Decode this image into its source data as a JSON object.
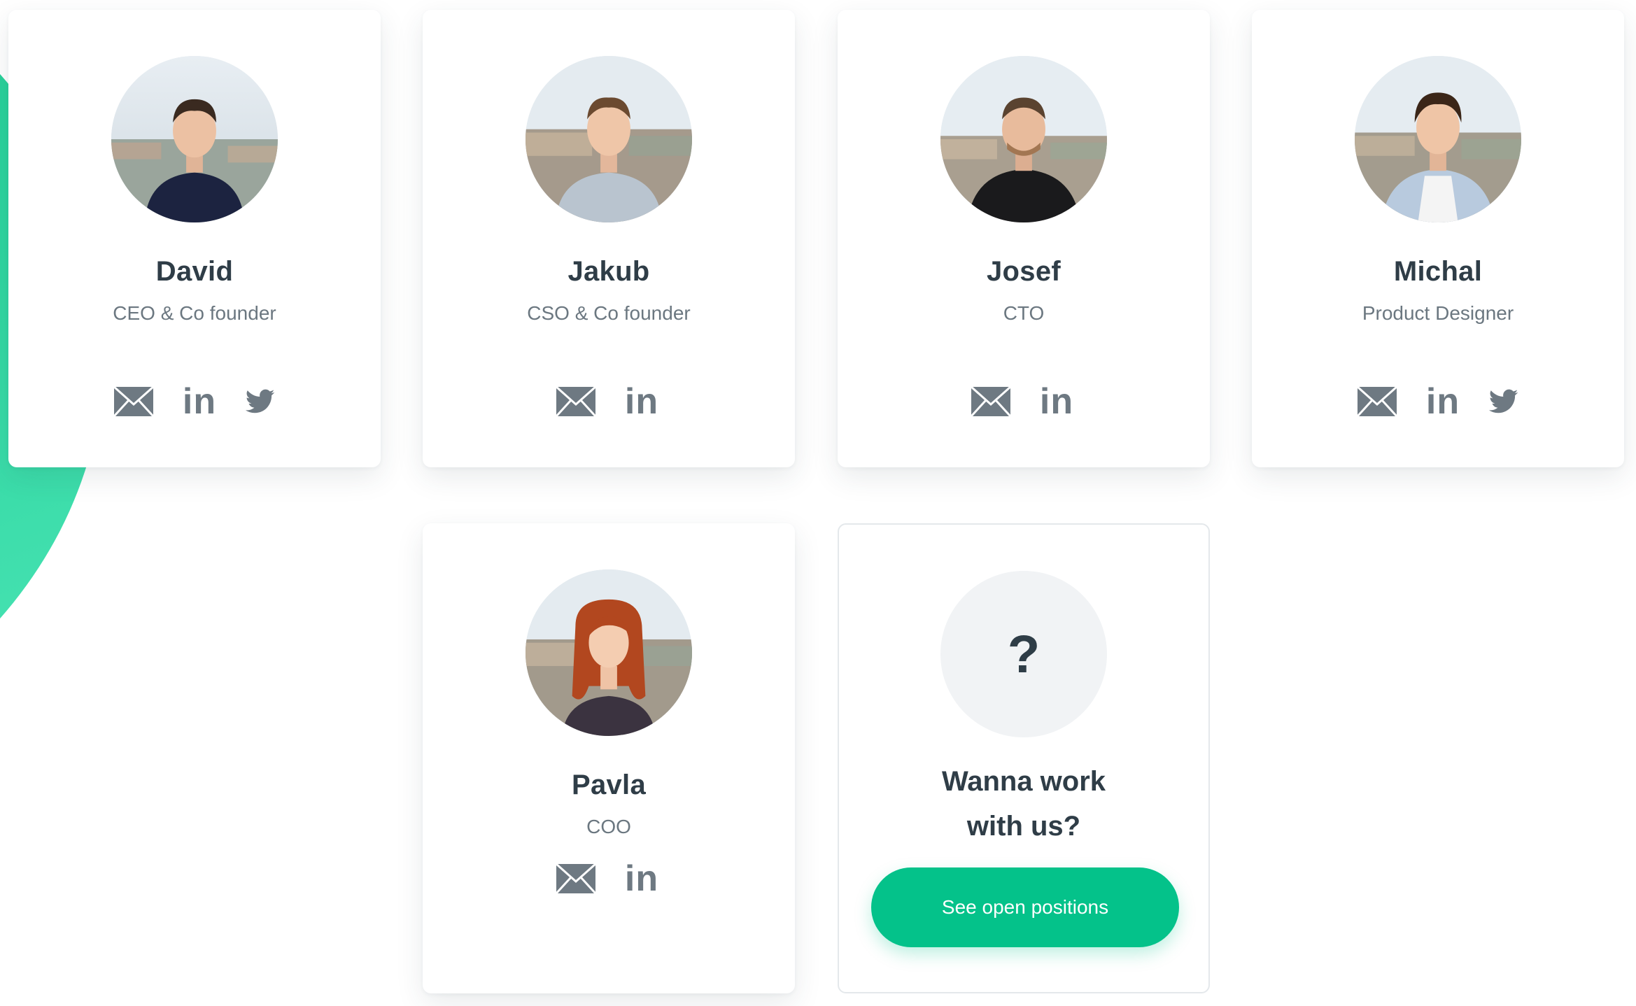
{
  "colors": {
    "accent": "#04c28a",
    "arc": "#2fd6a0",
    "heading": "#2f3d47",
    "muted": "#6b7780",
    "icon": "#6e7982"
  },
  "team": [
    {
      "name": "David",
      "role": "CEO & Co founder",
      "links": [
        "mail-icon",
        "linkedin-icon",
        "twitter-icon"
      ],
      "linkedin_label": "in"
    },
    {
      "name": "Jakub",
      "role": "CSO & Co founder",
      "links": [
        "mail-icon",
        "linkedin-icon"
      ],
      "linkedin_label": "in"
    },
    {
      "name": "Josef",
      "role": "CTO",
      "links": [
        "mail-icon",
        "linkedin-icon"
      ],
      "linkedin_label": "in"
    },
    {
      "name": "Michal",
      "role": "Product Designer",
      "links": [
        "mail-icon",
        "linkedin-icon",
        "twitter-icon"
      ],
      "linkedin_label": "in"
    },
    {
      "name": "Pavla",
      "role": "COO",
      "links": [
        "mail-icon",
        "linkedin-icon"
      ],
      "linkedin_label": "in"
    }
  ],
  "hiring": {
    "symbol": "?",
    "title_line1": "Wanna work",
    "title_line2": "with us?",
    "button_label": "See open positions"
  }
}
